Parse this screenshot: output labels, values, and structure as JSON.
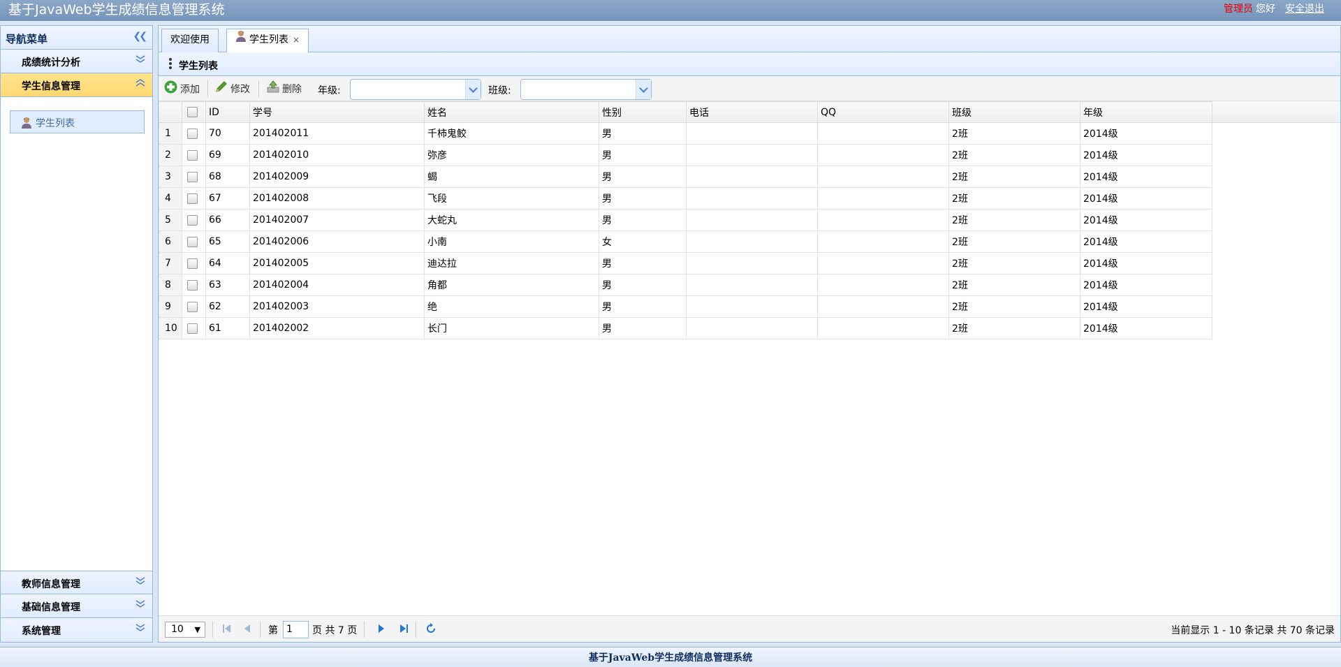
{
  "app": {
    "title": "基于JavaWeb学生成绩信息管理系统",
    "role": "管理员",
    "greeting": "您好",
    "logout": "安全退出"
  },
  "nav": {
    "header": "导航菜单",
    "sections": [
      {
        "label": "成绩统计分析"
      },
      {
        "label": "学生信息管理",
        "items": [
          {
            "label": "学生列表"
          }
        ]
      },
      {
        "label": "教师信息管理"
      },
      {
        "label": "基础信息管理"
      },
      {
        "label": "系统管理"
      }
    ]
  },
  "tabs": [
    {
      "label": "欢迎使用"
    },
    {
      "label": "学生列表",
      "close": "×"
    }
  ],
  "panel": {
    "title": "学生列表"
  },
  "toolbar": {
    "add": "添加",
    "edit": "修改",
    "delete": "删除",
    "grade_label": "年级:",
    "grade_value": "",
    "class_label": "班级:",
    "class_value": ""
  },
  "grid": {
    "columns": [
      "ID",
      "学号",
      "姓名",
      "性别",
      "电话",
      "QQ",
      "班级",
      "年级"
    ],
    "rows": [
      [
        "1",
        "70",
        "201402011",
        "千柿鬼鲛",
        "男",
        "",
        "",
        "2班",
        "2014级"
      ],
      [
        "2",
        "69",
        "201402010",
        "弥彦",
        "男",
        "",
        "",
        "2班",
        "2014级"
      ],
      [
        "3",
        "68",
        "201402009",
        "蝎",
        "男",
        "",
        "",
        "2班",
        "2014级"
      ],
      [
        "4",
        "67",
        "201402008",
        "飞段",
        "男",
        "",
        "",
        "2班",
        "2014级"
      ],
      [
        "5",
        "66",
        "201402007",
        "大蛇丸",
        "男",
        "",
        "",
        "2班",
        "2014级"
      ],
      [
        "6",
        "65",
        "201402006",
        "小南",
        "女",
        "",
        "",
        "2班",
        "2014级"
      ],
      [
        "7",
        "64",
        "201402005",
        "迪达拉",
        "男",
        "",
        "",
        "2班",
        "2014级"
      ],
      [
        "8",
        "63",
        "201402004",
        "角都",
        "男",
        "",
        "",
        "2班",
        "2014级"
      ],
      [
        "9",
        "62",
        "201402003",
        "绝",
        "男",
        "",
        "",
        "2班",
        "2014级"
      ],
      [
        "10",
        "61",
        "201402002",
        "长门",
        "男",
        "",
        "",
        "2班",
        "2014级"
      ]
    ]
  },
  "pager": {
    "page_size": "10",
    "page_prefix": "第",
    "page_number": "1",
    "page_suffix": "页 共 7 页",
    "info": "当前显示 1 - 10 条记录 共 70 条记录"
  },
  "footer": {
    "text": "基于JavaWeb学生成绩信息管理系统"
  },
  "colors": {
    "border": "#95b8e7",
    "header_bg": "#7795ba",
    "active_section": "#ffd772",
    "role_text": "#e60000"
  },
  "icons": [
    "double-chevron-left-icon",
    "double-chevron-down-icon",
    "double-chevron-up-icon",
    "user-icon",
    "add-icon",
    "edit-icon",
    "delete-icon",
    "first-page-icon",
    "prev-page-icon",
    "next-page-icon",
    "last-page-icon",
    "refresh-icon"
  ]
}
